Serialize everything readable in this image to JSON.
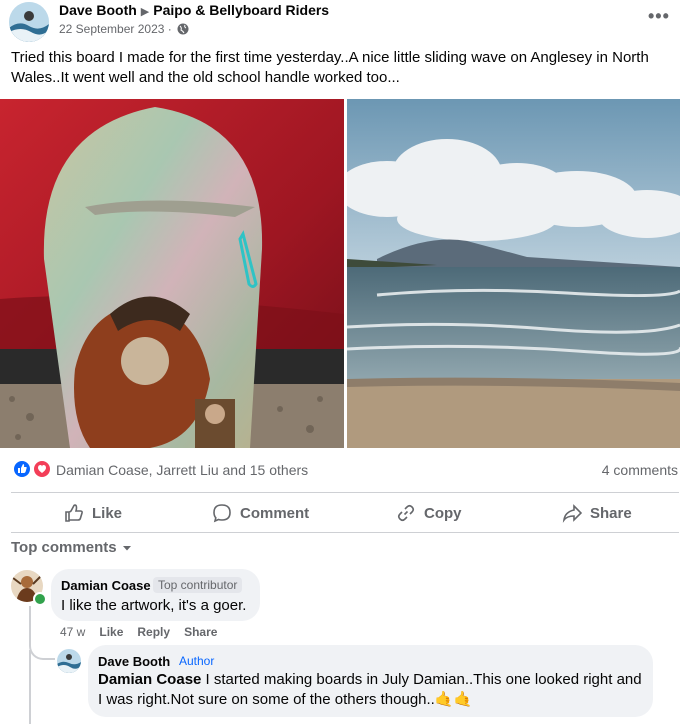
{
  "post": {
    "author": "Dave Booth",
    "group": "Paipo & Bellyboard Riders",
    "date": "22 September 2023 ·",
    "more_label": "•••",
    "text": "Tried this board I made for the first time yesterday..A nice little sliding wave on Anglesey in North Wales..It went well and the old school handle worked too..."
  },
  "reactions": {
    "names": "Damian Coase, Jarrett Liu and 15 others",
    "comments_count": "4 comments",
    "icons": [
      "like-icon",
      "love-icon"
    ]
  },
  "actions": {
    "like": "Like",
    "comment": "Comment",
    "copy": "Copy",
    "share": "Share"
  },
  "comments_filter": "Top comments",
  "comments": [
    {
      "name": "Damian Coase",
      "badge": "Top contributor",
      "text": "I like the artwork, it's a goer.",
      "time": "47 w",
      "like": "Like",
      "reply": "Reply",
      "share": "Share"
    },
    {
      "name": "Dave Booth",
      "badge": "Author",
      "mention": "Damian Coase",
      "text": " I started making boards in July Damian..This one looked right and I was right.Not sure on some of the others though..🤙🤙"
    }
  ],
  "colors": {
    "accent": "#0866ff",
    "secondary_text": "#65676b",
    "bubble": "#f0f2f5",
    "online": "#31a24c"
  }
}
